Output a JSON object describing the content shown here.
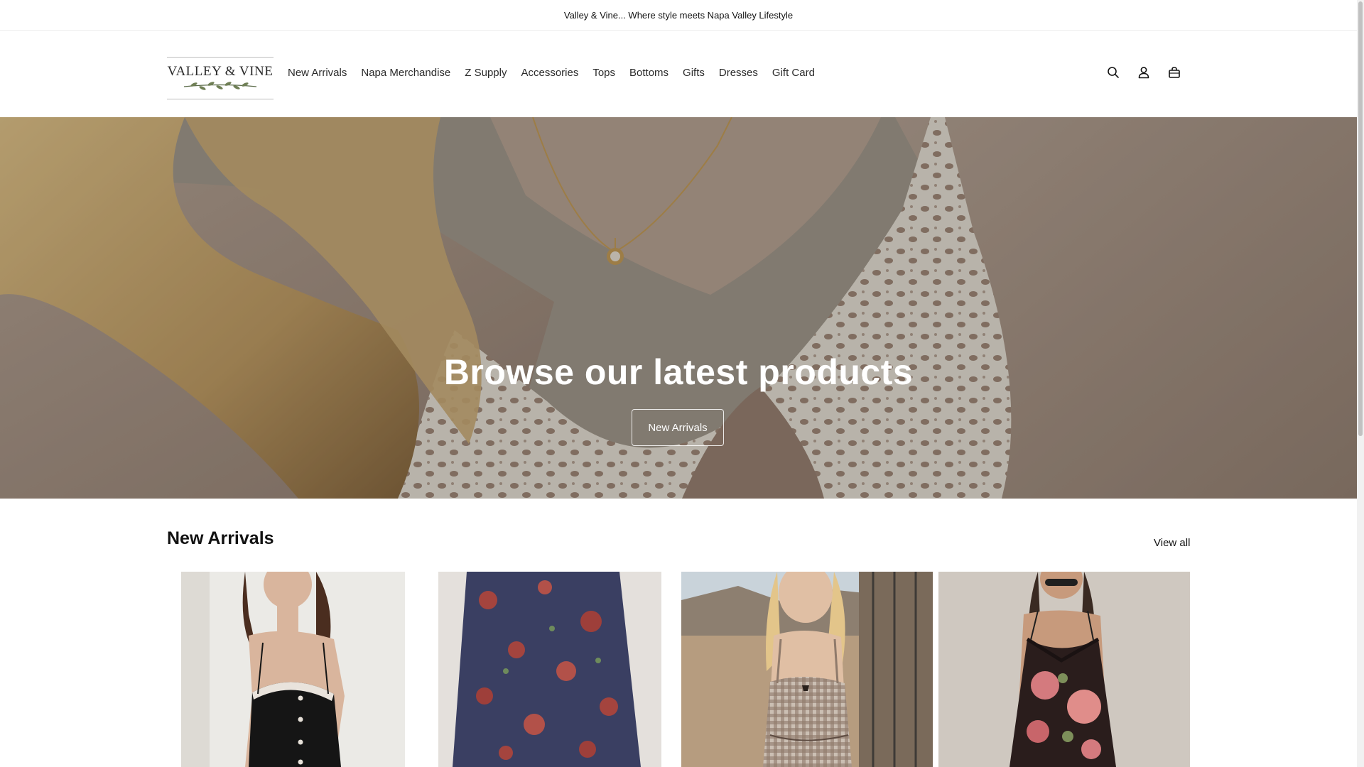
{
  "announcement": {
    "text": "Valley & Vine... Where style meets Napa Valley Lifestyle"
  },
  "header": {
    "logo_text": "VALLEY & VINE",
    "nav": [
      {
        "label": "New Arrivals"
      },
      {
        "label": "Napa Merchandise"
      },
      {
        "label": "Z Supply"
      },
      {
        "label": "Accessories"
      },
      {
        "label": "Tops"
      },
      {
        "label": "Bottoms"
      },
      {
        "label": "Gifts"
      },
      {
        "label": "Dresses"
      },
      {
        "label": "Gift Card"
      }
    ],
    "icons": [
      "search-icon",
      "account-icon",
      "cart-icon"
    ]
  },
  "hero": {
    "title": "Browse our latest products",
    "button_label": "New Arrivals"
  },
  "new_arrivals": {
    "title": "New Arrivals",
    "view_all_label": "View all",
    "products": [
      {
        "image": "black-button-front-mini-dress"
      },
      {
        "image": "navy-floral-maxi-skirt"
      },
      {
        "image": "gingham-tie-front-top"
      },
      {
        "image": "black-floral-lace-slip-dress"
      }
    ]
  },
  "colors": {
    "text": "#121212",
    "border": "#ececec",
    "hero_overlay_text": "#ffffff"
  }
}
